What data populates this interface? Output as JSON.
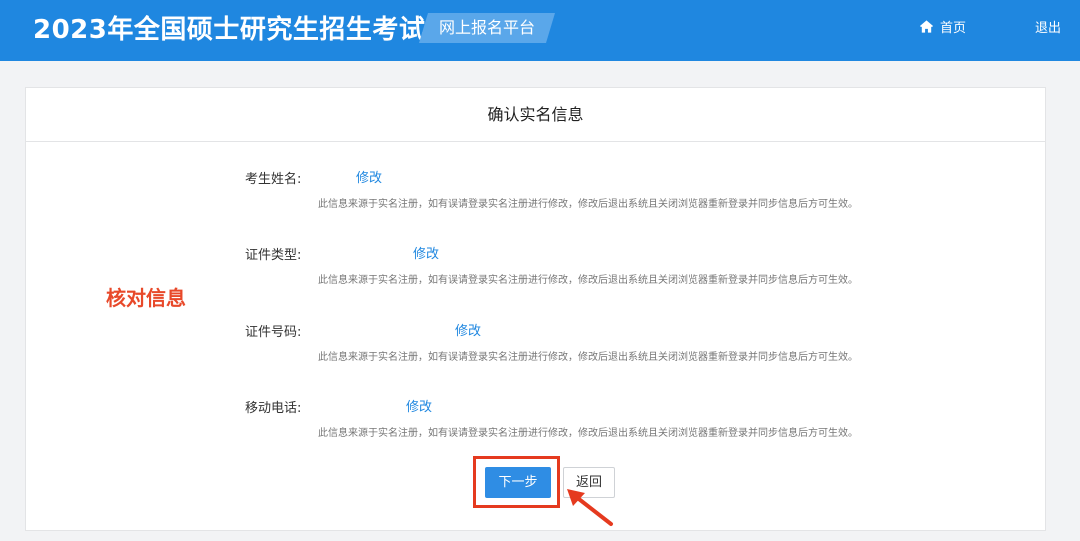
{
  "header": {
    "title": "2023年全国硕士研究生招生考试",
    "platform": "网上报名平台",
    "home_label": "首页",
    "logout_label": "退出"
  },
  "card": {
    "title": "确认实名信息",
    "side_label": "核对信息",
    "note": "此信息来源于实名注册，如有误请登录实名注册进行修改，修改后退出系统且关闭浏览器重新登录并同步信息后方可生效。",
    "edit_label": "修改",
    "fields": [
      {
        "label": "考生姓名:"
      },
      {
        "label": "证件类型:"
      },
      {
        "label": "证件号码:"
      },
      {
        "label": "移动电话:"
      }
    ],
    "next_label": "下一步",
    "back_label": "返回"
  },
  "colors": {
    "brand": "#1f87e0",
    "accent_red": "#e8492a",
    "link": "#1f87e0"
  }
}
